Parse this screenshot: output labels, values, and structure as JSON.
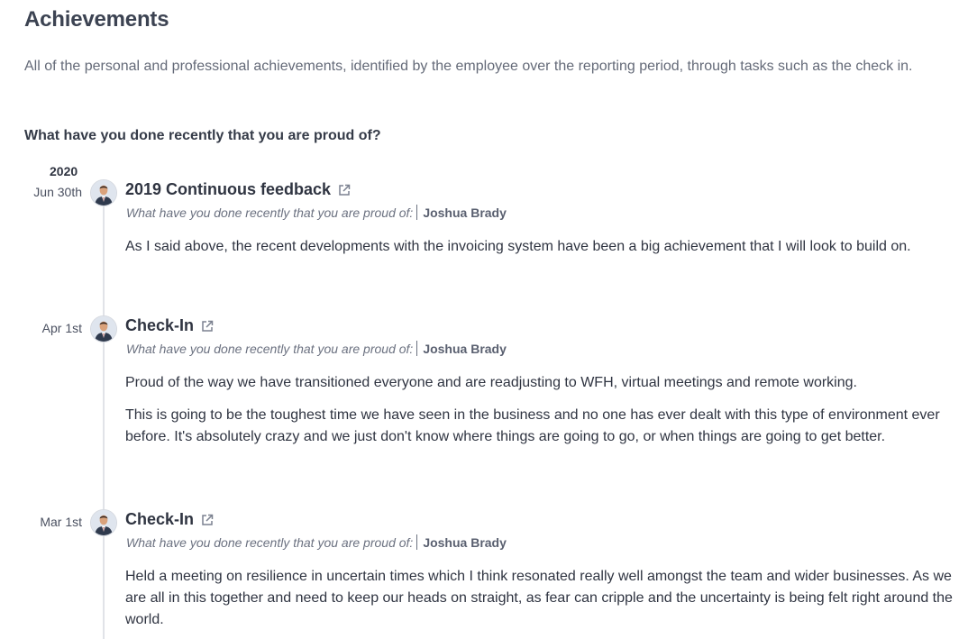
{
  "section": {
    "title": "Achievements",
    "description": "All of the personal and professional achievements, identified by the employee over the reporting period, through tasks such as the check in.",
    "question": "What have you done recently that you are proud of?"
  },
  "timeline": {
    "year": "2020",
    "entries": [
      {
        "date": "Jun 30th",
        "title": "2019 Continuous feedback",
        "question_label": "What have you done recently that you are proud of:",
        "author": "Joshua Brady",
        "paragraphs": [
          "As I said above, the recent developments with the invoicing system have been a big achievement that I will look to build on."
        ]
      },
      {
        "date": "Apr 1st",
        "title": "Check-In",
        "question_label": "What have you done recently that you are proud of:",
        "author": "Joshua Brady",
        "paragraphs": [
          "Proud of the way we have transitioned everyone and are readjusting to WFH, virtual meetings and remote working.",
          "This is going to be the toughest time we have seen in the business and no one has ever dealt with this type of environment ever before. It's absolutely crazy and we just don't know where things are going to go, or when things are going to get better."
        ]
      },
      {
        "date": "Mar 1st",
        "title": "Check-In",
        "question_label": "What have you done recently that you are proud of:",
        "author": "Joshua Brady",
        "paragraphs": [
          "Held a meeting on resilience in uncertain times which I think resonated really well amongst the team and wider businesses. As we are all in this together and need to keep our heads on straight, as fear can cripple and the uncertainty is being felt right around the world."
        ]
      }
    ]
  },
  "icons": {
    "external_link": "external-link-icon",
    "avatar": "user-avatar"
  },
  "colors": {
    "text_primary": "#2f3441",
    "text_muted": "#646a78",
    "timeline_line": "#e1e3e8"
  }
}
